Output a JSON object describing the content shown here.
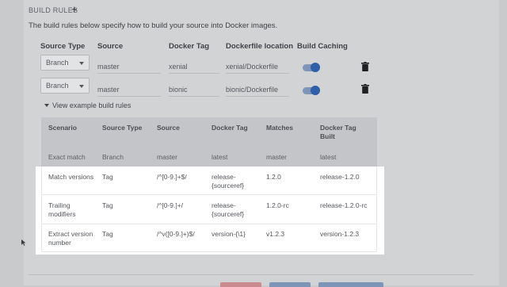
{
  "header": {
    "title": "BUILD RULES",
    "add_symbol": "+"
  },
  "description": "The build rules below specify how to build your source into Docker images.",
  "columns": {
    "source_type": "Source Type",
    "source": "Source",
    "docker_tag": "Docker Tag",
    "dockerfile_location": "Dockerfile location",
    "build_caching": "Build Caching"
  },
  "rules": [
    {
      "source_type": "Branch",
      "source": "master",
      "docker_tag": "xenial",
      "dockerfile": "xenial/Dockerfile",
      "caching": true
    },
    {
      "source_type": "Branch",
      "source": "master",
      "docker_tag": "bionic",
      "dockerfile": "bionic/Dockerfile",
      "caching": true
    }
  ],
  "examples_toggle": "View example build rules",
  "examples": {
    "headers": [
      "Scenario",
      "Source Type",
      "Source",
      "Docker Tag",
      "Matches",
      "Docker Tag Built"
    ],
    "rows": [
      {
        "scenario": "Exact match",
        "source_type": "Branch",
        "source": "master",
        "docker_tag": "latest",
        "matches": "master",
        "built": "latest"
      },
      {
        "scenario": "Match versions",
        "source_type": "Tag",
        "source": "/^[0-9.]+$/",
        "docker_tag": "release-{sourceref}",
        "matches": "1.2.0",
        "built": "release-1.2.0"
      },
      {
        "scenario": "Trailing modifiers",
        "source_type": "Tag",
        "source": "/^[0-9.]+/",
        "docker_tag": "release-{sourceref}",
        "matches": "1.2.0-rc",
        "built": "release-1.2.0-rc"
      },
      {
        "scenario": "Extract version number",
        "source_type": "Tag",
        "source": "/^v([0-9.]+)$/",
        "docker_tag": "version-{\\1}",
        "matches": "v1.2.3",
        "built": "version-1.2.3"
      }
    ]
  },
  "colors": {
    "toggle_on": "#2e5fa8",
    "highlight_bg": "#ffffff",
    "overlay_bg": "#c9cacc"
  }
}
